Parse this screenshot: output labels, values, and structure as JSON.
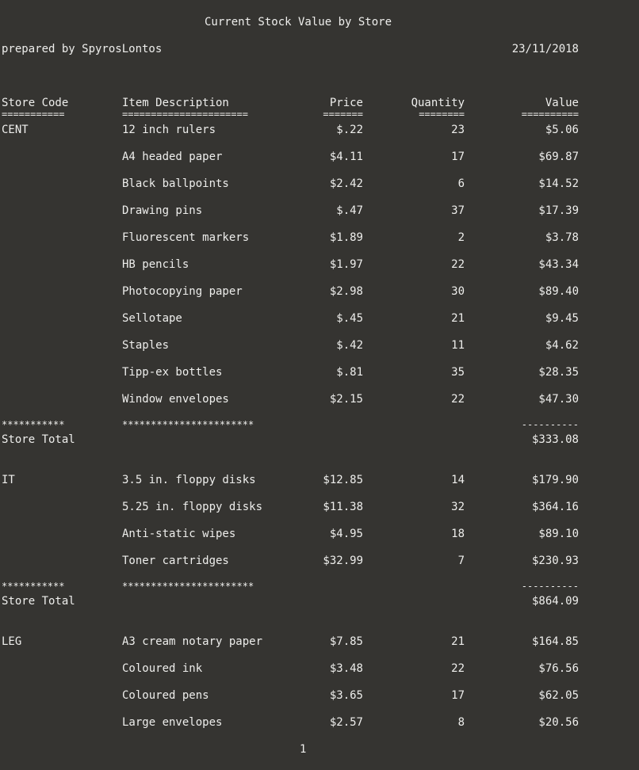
{
  "report": {
    "title": "Current Stock Value by Store",
    "prepared_by": "prepared by SpyrosLontos",
    "date": "23/11/2018",
    "page_number": "1"
  },
  "columns": {
    "store": "Store Code",
    "desc": "Item Description",
    "price": "Price",
    "qty": "Quantity",
    "value": "Value"
  },
  "underlines": {
    "store": "===========",
    "desc": "======================",
    "price": "=======",
    "qty": "========",
    "value": "=========="
  },
  "group_separator": {
    "store": "***********",
    "desc": "***********************",
    "value": "----------"
  },
  "store_total_label": "Store Total",
  "groups": [
    {
      "code": "CENT",
      "rows": [
        {
          "desc": "12 inch rulers",
          "price": "$.22",
          "qty": "23",
          "value": "$5.06"
        },
        {
          "desc": "A4 headed paper",
          "price": "$4.11",
          "qty": "17",
          "value": "$69.87"
        },
        {
          "desc": "Black ballpoints",
          "price": "$2.42",
          "qty": "6",
          "value": "$14.52"
        },
        {
          "desc": "Drawing pins",
          "price": "$.47",
          "qty": "37",
          "value": "$17.39"
        },
        {
          "desc": "Fluorescent markers",
          "price": "$1.89",
          "qty": "2",
          "value": "$3.78"
        },
        {
          "desc": "HB pencils",
          "price": "$1.97",
          "qty": "22",
          "value": "$43.34"
        },
        {
          "desc": "Photocopying paper",
          "price": "$2.98",
          "qty": "30",
          "value": "$89.40"
        },
        {
          "desc": "Sellotape",
          "price": "$.45",
          "qty": "21",
          "value": "$9.45"
        },
        {
          "desc": "Staples",
          "price": "$.42",
          "qty": "11",
          "value": "$4.62"
        },
        {
          "desc": "Tipp-ex bottles",
          "price": "$.81",
          "qty": "35",
          "value": "$28.35"
        },
        {
          "desc": "Window envelopes",
          "price": "$2.15",
          "qty": "22",
          "value": "$47.30"
        }
      ],
      "total": "$333.08"
    },
    {
      "code": "IT",
      "rows": [
        {
          "desc": "3.5 in. floppy disks",
          "price": "$12.85",
          "qty": "14",
          "value": "$179.90"
        },
        {
          "desc": "5.25 in. floppy disks",
          "price": "$11.38",
          "qty": "32",
          "value": "$364.16"
        },
        {
          "desc": "Anti-static wipes",
          "price": "$4.95",
          "qty": "18",
          "value": "$89.10"
        },
        {
          "desc": "Toner cartridges",
          "price": "$32.99",
          "qty": "7",
          "value": "$230.93"
        }
      ],
      "total": "$864.09"
    },
    {
      "code": "LEG",
      "rows": [
        {
          "desc": "A3 cream notary paper",
          "price": "$7.85",
          "qty": "21",
          "value": "$164.85"
        },
        {
          "desc": "Coloured ink",
          "price": "$3.48",
          "qty": "22",
          "value": "$76.56"
        },
        {
          "desc": "Coloured pens",
          "price": "$3.65",
          "qty": "17",
          "value": "$62.05"
        },
        {
          "desc": "Large envelopes",
          "price": "$2.57",
          "qty": "8",
          "value": "$20.56"
        }
      ]
    }
  ]
}
